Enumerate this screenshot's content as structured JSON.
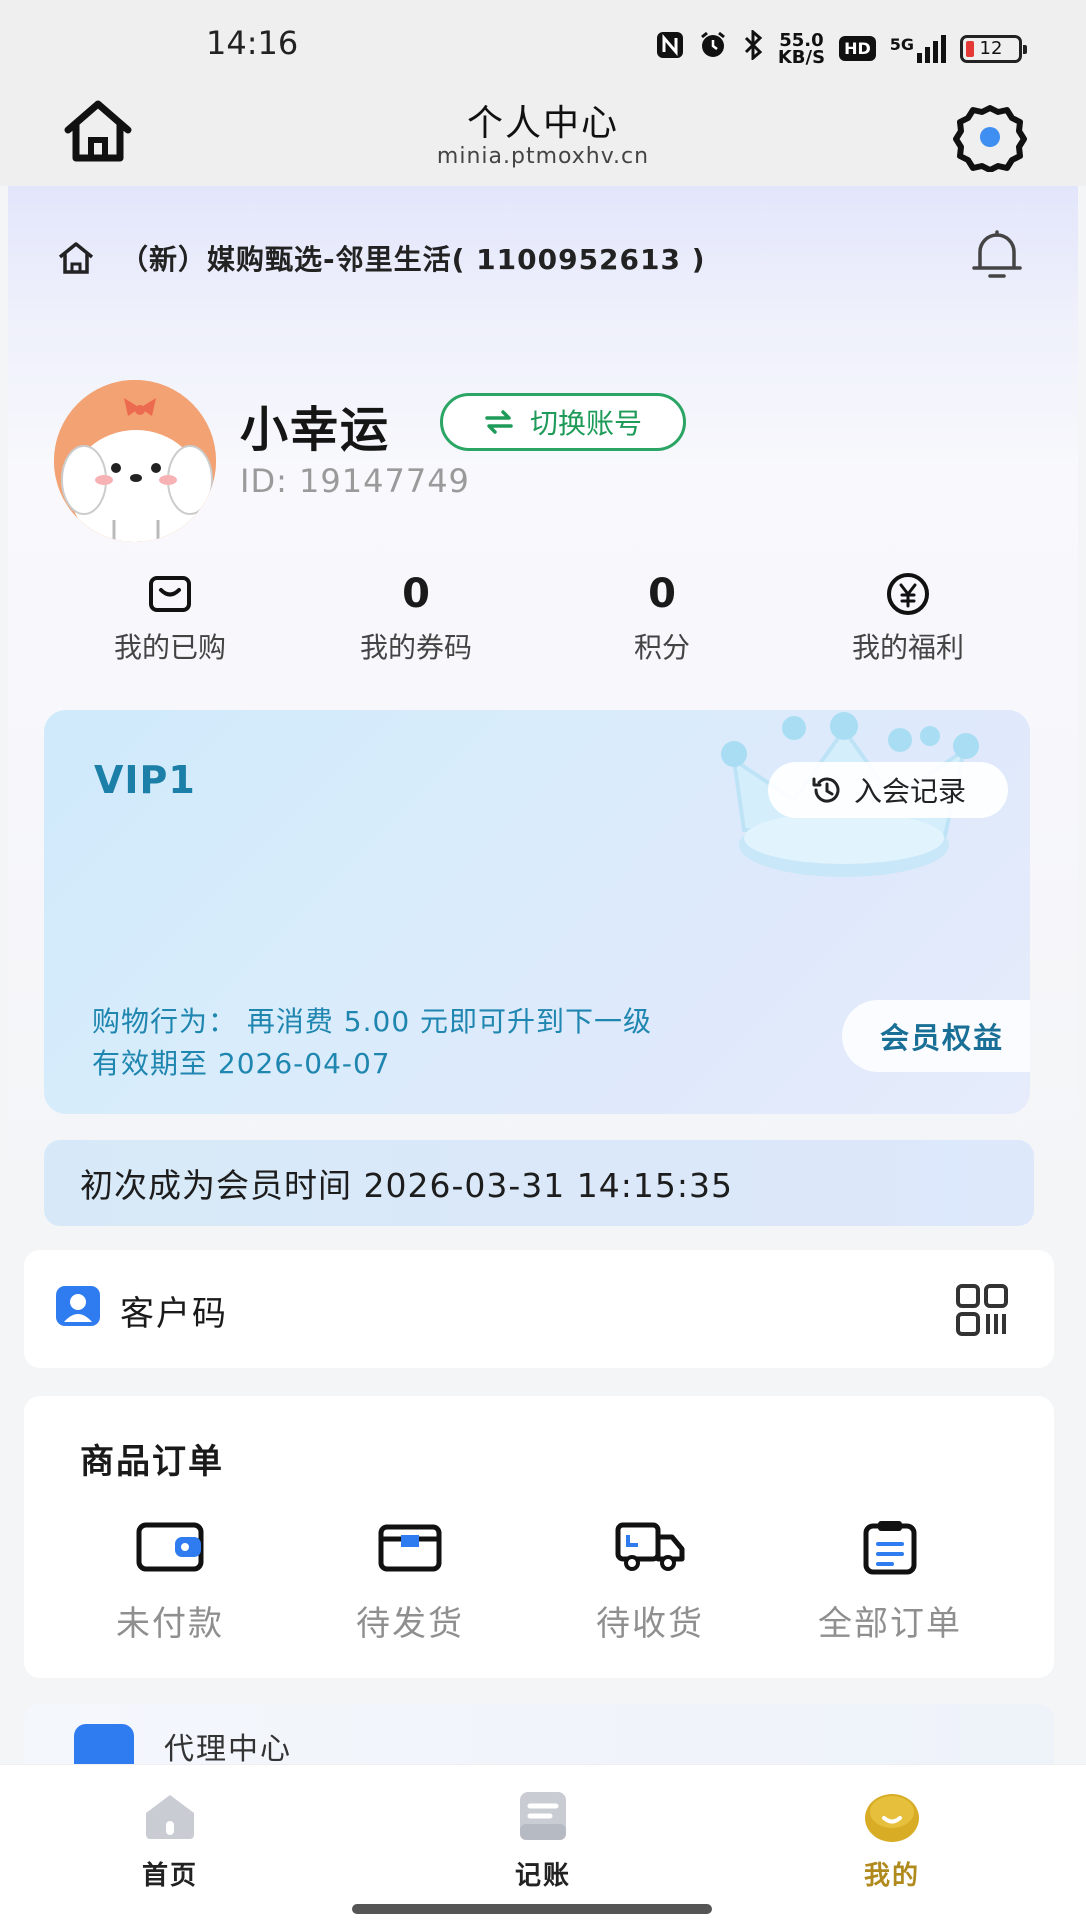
{
  "status_bar": {
    "time": "14:16",
    "net_speed_value": "55.0",
    "net_speed_unit": "KB/S",
    "hd": "HD",
    "signal": "5G",
    "battery": "12"
  },
  "title_bar": {
    "title": "个人中心",
    "subtitle": "minia.ptmoxhv.cn"
  },
  "store": {
    "name": "（新）媒购甄选-邻里生活( 1100952613 )"
  },
  "profile": {
    "nickname": "小幸运",
    "switch_account_label": "切换账号",
    "user_id": "ID: 19147749"
  },
  "stats": [
    {
      "label": "我的已购",
      "icon": "bag-icon"
    },
    {
      "label": "我的券码",
      "value": "0"
    },
    {
      "label": "积分",
      "value": "0"
    },
    {
      "label": "我的福利",
      "icon": "yen-coin-icon"
    }
  ],
  "vip": {
    "level": "VIP1",
    "join_record_label": "入会记录",
    "upgrade_text": "购物行为：  再消费 5.00 元即可升到下一级",
    "valid_until": "有效期至 2026-04-07",
    "benefits_label": "会员权益"
  },
  "first_member_text": "初次成为会员时间 2026-03-31 14:15:35",
  "customer_code": {
    "label": "客户码"
  },
  "orders": {
    "title": "商品订单",
    "items": [
      {
        "label": "未付款",
        "icon": "wallet-icon"
      },
      {
        "label": "待发货",
        "icon": "box-icon"
      },
      {
        "label": "待收货",
        "icon": "truck-icon"
      },
      {
        "label": "全部订单",
        "icon": "clipboard-icon"
      }
    ]
  },
  "agent": {
    "title": "代理中心"
  },
  "bottom_nav": [
    {
      "label": "首页",
      "icon": "home-icon",
      "active": false
    },
    {
      "label": "记账",
      "icon": "ledger-icon",
      "active": false
    },
    {
      "label": "我的",
      "icon": "profile-face-icon",
      "active": true
    }
  ],
  "colors": {
    "accent_green": "#2aa564",
    "vip_text_blue": "#1f86b0",
    "active_nav_gold": "#b08a1c"
  }
}
